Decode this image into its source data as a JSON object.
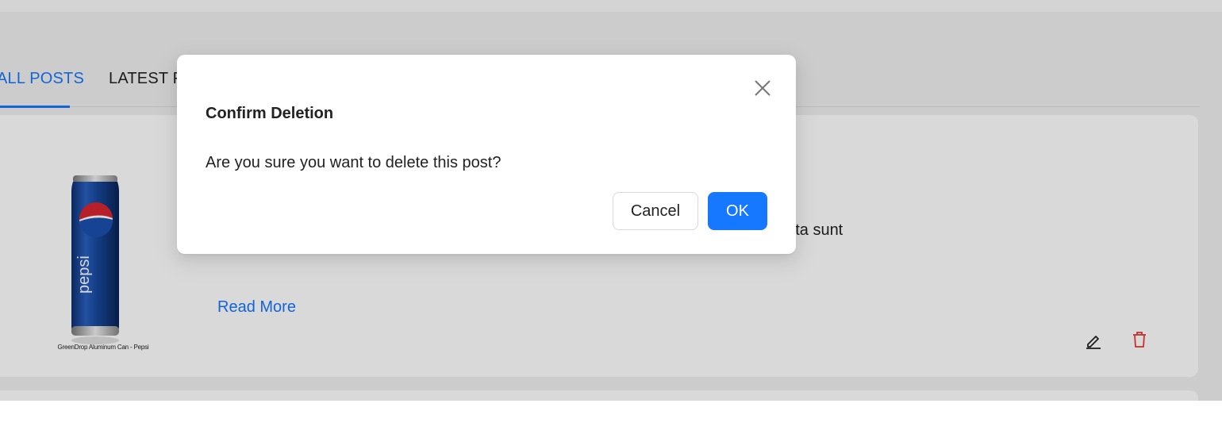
{
  "tabs": [
    {
      "label": "ALL POSTS",
      "active": true
    },
    {
      "label": "LATEST POSTS",
      "active": false
    }
  ],
  "post": {
    "image_caption": "GreenDrop Aluminum Can - Pepsi",
    "body": "ore molestiae sunt dolor eveniet hic recusandae veniam tempora et tenetur expedita sunt",
    "read_more": "Read More",
    "actions": {
      "edit_icon": "edit-icon",
      "delete_icon": "delete-icon"
    }
  },
  "modal": {
    "title": "Confirm Deletion",
    "message": "Are you sure you want to delete this post?",
    "cancel_label": "Cancel",
    "ok_label": "OK"
  },
  "colors": {
    "accent": "#1677ff",
    "danger": "#e53935",
    "can_blue": "#17489a",
    "can_red": "#d8262f"
  }
}
